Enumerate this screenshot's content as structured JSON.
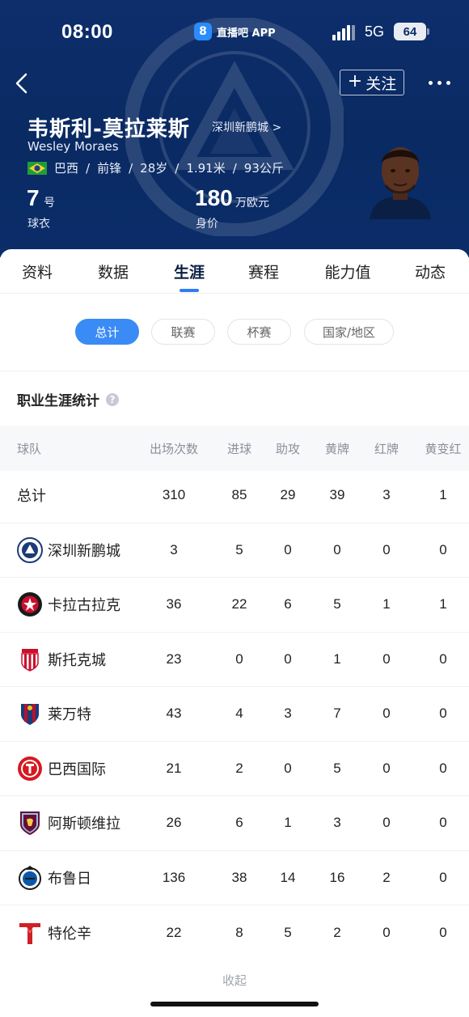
{
  "status_bar": {
    "time": "08:00",
    "app_label": "直播吧 APP",
    "app_logo": "8",
    "network": "5G",
    "battery": "64"
  },
  "header": {
    "follow_label": "关注",
    "player_name": "韦斯利-莫拉莱斯",
    "club_link": "深圳新鹏城 >",
    "english_name": "Wesley Moraes",
    "meta": [
      "巴西",
      "前锋",
      "28岁",
      "1.91米",
      "93公斤"
    ],
    "shirt_number": "7",
    "shirt_unit": "号",
    "shirt_label": "球衣",
    "value_number": "180",
    "value_unit": "万欧元",
    "value_label": "身价"
  },
  "tabs": [
    "资料",
    "数据",
    "生涯",
    "赛程",
    "能力值",
    "动态"
  ],
  "active_tab": "生涯",
  "filters": [
    "总计",
    "联赛",
    "杯赛",
    "国家/地区"
  ],
  "active_filter": "总计",
  "section_title": "职业生涯统计",
  "table": {
    "headers": [
      "球队",
      "出场次数",
      "进球",
      "助攻",
      "黄牌",
      "红牌",
      "黄变红"
    ],
    "total": {
      "team": "总计",
      "values": [
        "310",
        "85",
        "29",
        "39",
        "3",
        "1"
      ]
    },
    "rows": [
      {
        "team": "深圳新鹏城",
        "crest": "shenzhen-peng-city-crest",
        "values": [
          "3",
          "5",
          "0",
          "0",
          "0",
          "0"
        ]
      },
      {
        "team": "卡拉古拉克",
        "crest": "karagumruk-crest",
        "values": [
          "36",
          "22",
          "6",
          "5",
          "1",
          "1"
        ]
      },
      {
        "team": "斯托克城",
        "crest": "stoke-city-crest",
        "values": [
          "23",
          "0",
          "0",
          "1",
          "0",
          "0"
        ]
      },
      {
        "team": "莱万特",
        "crest": "levante-crest",
        "values": [
          "43",
          "4",
          "3",
          "7",
          "0",
          "0"
        ]
      },
      {
        "team": "巴西国际",
        "crest": "internacional-crest",
        "values": [
          "21",
          "2",
          "0",
          "5",
          "0",
          "0"
        ]
      },
      {
        "team": "阿斯顿维拉",
        "crest": "aston-villa-crest",
        "values": [
          "26",
          "6",
          "1",
          "3",
          "0",
          "0"
        ]
      },
      {
        "team": "布鲁日",
        "crest": "club-brugge-crest",
        "values": [
          "136",
          "38",
          "14",
          "16",
          "2",
          "0"
        ]
      },
      {
        "team": "特伦辛",
        "crest": "trencin-crest",
        "values": [
          "22",
          "8",
          "5",
          "2",
          "0",
          "0"
        ]
      }
    ]
  },
  "collapse_label": "收起",
  "colors": {
    "header_bg": "#0b2d69",
    "accent": "#3a8bf6"
  }
}
